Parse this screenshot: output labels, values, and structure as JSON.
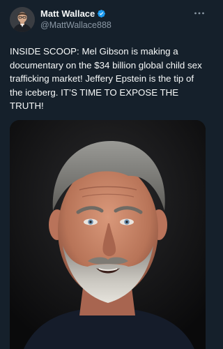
{
  "author": {
    "display_name": "Matt Wallace",
    "handle": "@MattWallace888",
    "verified": true
  },
  "more_icon": "more-horizontal-icon",
  "post": {
    "text": "INSIDE SCOOP: Mel Gibson is making a documentary on the $34 billion global child sex trafficking market! Jeffery Epstein is the tip of the iceberg. IT’S TIME TO EXPOSE THE TRUTH!"
  },
  "media": {
    "type": "photo",
    "subject": "portrait-of-bearded-man"
  },
  "colors": {
    "background": "#15202b",
    "text": "#f7f9f9",
    "secondary_text": "#8b98a5",
    "verified_badge": "#1d9bf0"
  }
}
